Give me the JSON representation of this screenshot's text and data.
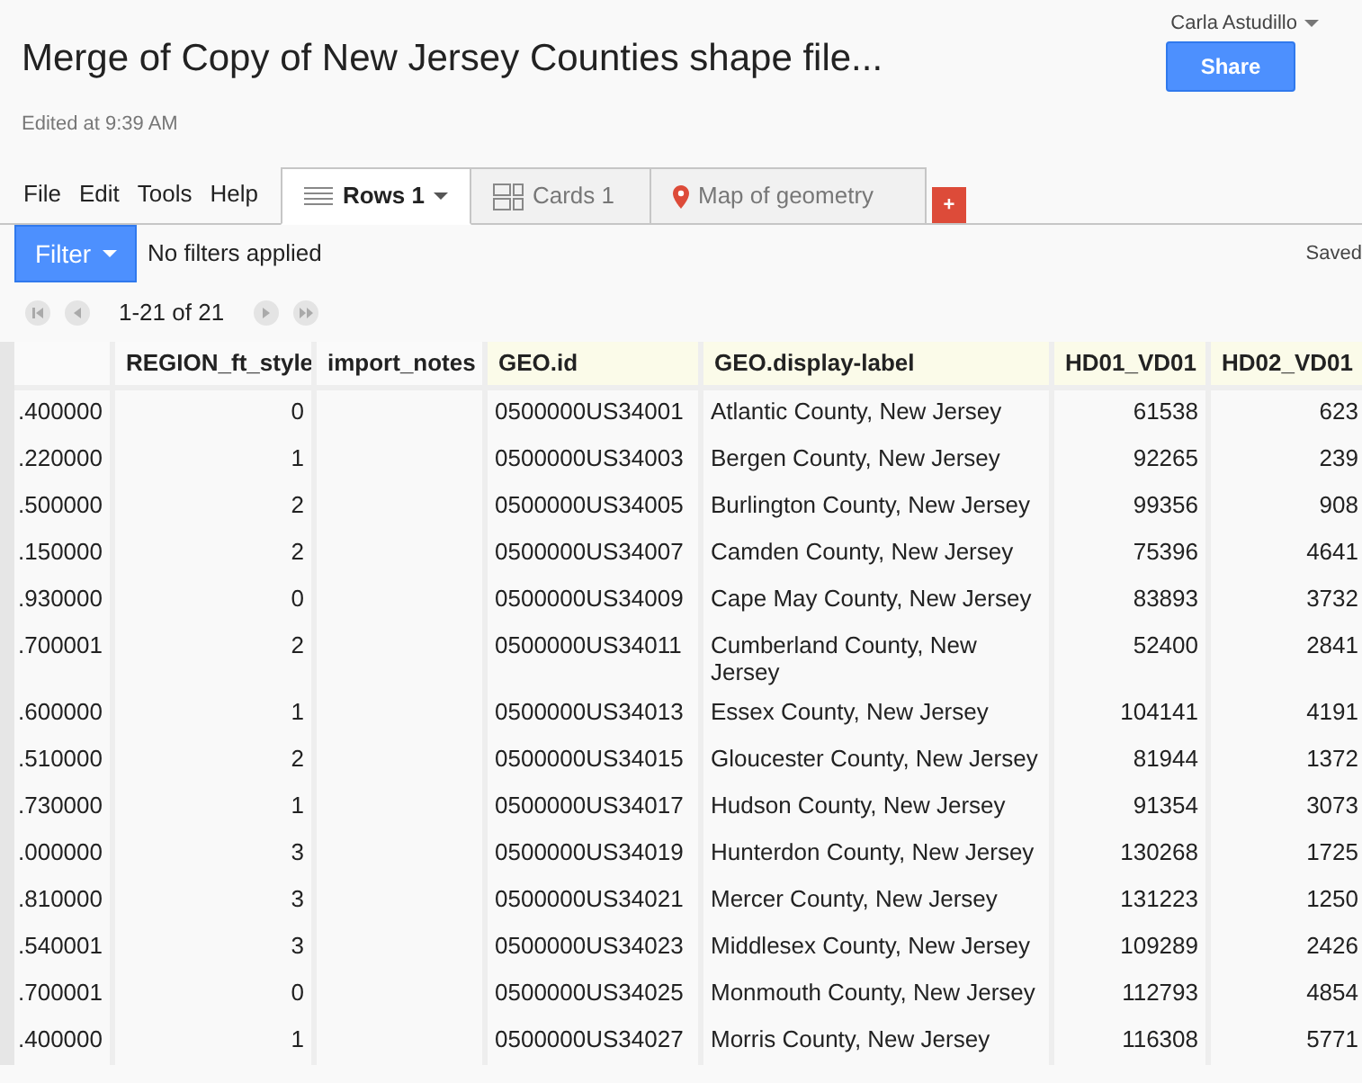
{
  "header": {
    "title": "Merge of Copy of New Jersey Counties shape file...",
    "user": "Carla Astudillo",
    "share_button": "Share",
    "edited": "Edited at 9:39 AM"
  },
  "menu": [
    "File",
    "Edit",
    "Tools",
    "Help"
  ],
  "tabs": [
    {
      "label": "Rows 1",
      "kind": "rows",
      "selected": true
    },
    {
      "label": "Cards 1",
      "kind": "cards",
      "selected": false
    },
    {
      "label": "Map of geometry",
      "kind": "map",
      "selected": false
    }
  ],
  "add_tab_button": "+",
  "filter": {
    "button": "Filter",
    "status": "No filters applied",
    "saved": "Saved"
  },
  "pager": {
    "range": "1-21 of 21"
  },
  "table": {
    "columns": [
      {
        "highlighted": false
      },
      {
        "label": "REGION_ft_style",
        "highlighted": false
      },
      {
        "label": "import_notes",
        "highlighted": false
      },
      {
        "label": "GEO.id",
        "highlighted": true
      },
      {
        "label": "GEO.display-label",
        "highlighted": true
      },
      {
        "label": "HD01_VD01",
        "highlighted": true
      },
      {
        "label": "HD02_VD01",
        "highlighted": true
      }
    ],
    "rows": [
      [
        ".400000",
        "0",
        "",
        "0500000US34001",
        "Atlantic County, New Jersey",
        "61538",
        "623"
      ],
      [
        ".220000",
        "1",
        "",
        "0500000US34003",
        "Bergen County, New Jersey",
        "92265",
        "239"
      ],
      [
        ".500000",
        "2",
        "",
        "0500000US34005",
        "Burlington County, New Jersey",
        "99356",
        "908"
      ],
      [
        ".150000",
        "2",
        "",
        "0500000US34007",
        "Camden County, New Jersey",
        "75396",
        "4641"
      ],
      [
        ".930000",
        "0",
        "",
        "0500000US34009",
        "Cape May County, New Jersey",
        "83893",
        "3732"
      ],
      [
        ".700001",
        "2",
        "",
        "0500000US34011",
        "Cumberland County, New Jersey",
        "52400",
        "2841"
      ],
      [
        ".600000",
        "1",
        "",
        "0500000US34013",
        "Essex County, New Jersey",
        "104141",
        "4191"
      ],
      [
        ".510000",
        "2",
        "",
        "0500000US34015",
        "Gloucester County, New Jersey",
        "81944",
        "1372"
      ],
      [
        ".730000",
        "1",
        "",
        "0500000US34017",
        "Hudson County, New Jersey",
        "91354",
        "3073"
      ],
      [
        ".000000",
        "3",
        "",
        "0500000US34019",
        "Hunterdon County, New Jersey",
        "130268",
        "1725"
      ],
      [
        ".810000",
        "3",
        "",
        "0500000US34021",
        "Mercer County, New Jersey",
        "131223",
        "1250"
      ],
      [
        ".540001",
        "3",
        "",
        "0500000US34023",
        "Middlesex County, New Jersey",
        "109289",
        "2426"
      ],
      [
        ".700001",
        "0",
        "",
        "0500000US34025",
        "Monmouth County, New Jersey",
        "112793",
        "4854"
      ],
      [
        ".400000",
        "1",
        "",
        "0500000US34027",
        "Morris County, New Jersey",
        "116308",
        "5771"
      ]
    ]
  }
}
